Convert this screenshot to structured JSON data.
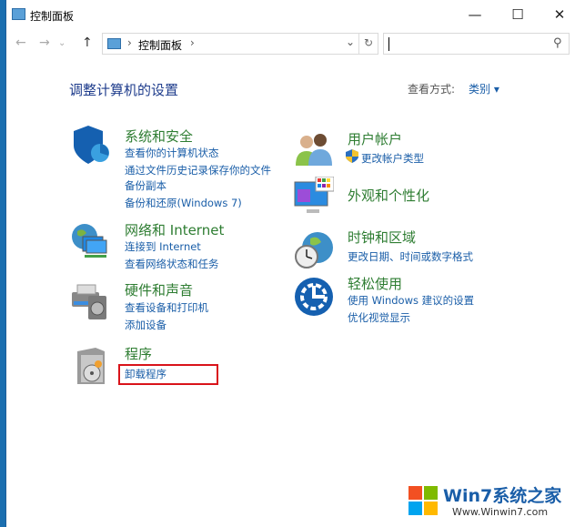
{
  "window": {
    "title": "控制面板",
    "minimize": "—",
    "maximize": "☐",
    "close": "✕"
  },
  "nav": {
    "back": "←",
    "forward": "→",
    "recent": "⌄",
    "up": "↑",
    "breadcrumb": [
      "控制面板"
    ],
    "sep": "›",
    "dropdown": "⌄",
    "refresh": "↻",
    "search_value": "",
    "search_icon": "⚲"
  },
  "main": {
    "heading": "调整计算机的设置",
    "view_label": "查看方式:",
    "view_value": "类别",
    "view_arrow": "▾"
  },
  "categories": [
    {
      "title": "系统和安全",
      "links": [
        "查看你的计算机状态",
        "通过文件历史记录保存你的文件",
        "备份副本",
        "备份和还原(Windows 7)"
      ]
    },
    {
      "title": "网络和 Internet",
      "links": [
        "连接到 Internet",
        "查看网络状态和任务"
      ]
    },
    {
      "title": "硬件和声音",
      "links": [
        "查看设备和打印机",
        "添加设备"
      ]
    },
    {
      "title": "程序",
      "links": [
        "卸载程序"
      ]
    },
    {
      "title": "用户帐户",
      "links": [
        "更改帐户类型"
      ]
    },
    {
      "title": "外观和个性化",
      "links": []
    },
    {
      "title": "时钟和区域",
      "links": [
        "更改日期、时间或数字格式"
      ]
    },
    {
      "title": "轻松使用",
      "links": [
        "使用 Windows 建议的设置",
        "优化视觉显示"
      ]
    }
  ],
  "watermark": {
    "brand": "Win7系统之家",
    "url": "Www.Winwin7.com"
  },
  "colors": {
    "highlight": "#d9131a",
    "link": "#1a5ea8",
    "category": "#2e7d32"
  }
}
